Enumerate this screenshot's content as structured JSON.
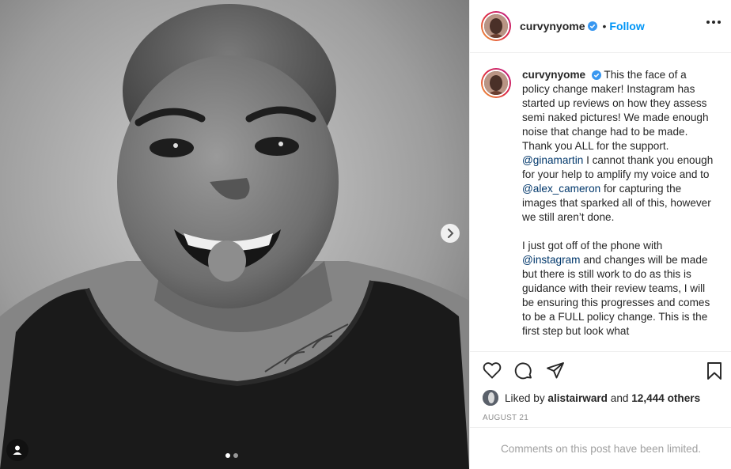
{
  "post": {
    "username": "curvynyome",
    "verified": true,
    "follow_label": "Follow",
    "header_separator": "•",
    "carousel": {
      "count": 2,
      "current": 1
    },
    "caption": {
      "username": "curvynyome",
      "segments_1": [
        {
          "text": "This the face of a policy change maker! Instagram has started up reviews on how they assess semi naked pictures! We made enough noise that change had to be made. Thank you ALL for the support. ",
          "type": "text"
        },
        {
          "text": "@ginamartin",
          "type": "mention"
        },
        {
          "text": " I cannot thank you enough for your help to amplify my voice and to ",
          "type": "text"
        },
        {
          "text": "@alex_cameron",
          "type": "mention"
        },
        {
          "text": " for capturing the images that sparked all of this, however we still aren’t done.",
          "type": "text"
        }
      ],
      "p1_a": "This the face of a policy change maker! Instagram has started up reviews on how they assess semi naked pictures! We made enough noise that change had to be made. Thank you ALL for the support.",
      "mention_1": "@ginamartin",
      "p1_b": "I cannot thank you enough for your help to amplify my voice and to",
      "mention_2": "@alex_cameron",
      "p1_c": "for capturing the images that sparked all of this, however we still aren’t done.",
      "p2_a": "I just got off of the phone with",
      "mention_3": "@instagram",
      "p2_b": "and changes will be made but there is still work to do as this is guidance with their review teams, I will be ensuring this progresses and comes to be a FULL policy change.",
      "p3_partial": "This is the first step but look what"
    },
    "likes": {
      "prefix": "Liked by",
      "user": "alistairward",
      "conjunction": "and",
      "others": "12,444 others"
    },
    "date": "AUGUST 21",
    "comments_limited": "Comments on this post have been limited."
  },
  "icons": {
    "like": "heart-icon",
    "comment": "comment-icon",
    "share": "paper-plane-icon",
    "save": "bookmark-icon",
    "more": "more-options-icon",
    "next": "chevron-right-icon",
    "tags": "user-tag-icon"
  },
  "colors": {
    "accent": "#0095f6",
    "mention": "#00376b",
    "verified": "#3897f0",
    "muted": "#8e8e8e"
  }
}
